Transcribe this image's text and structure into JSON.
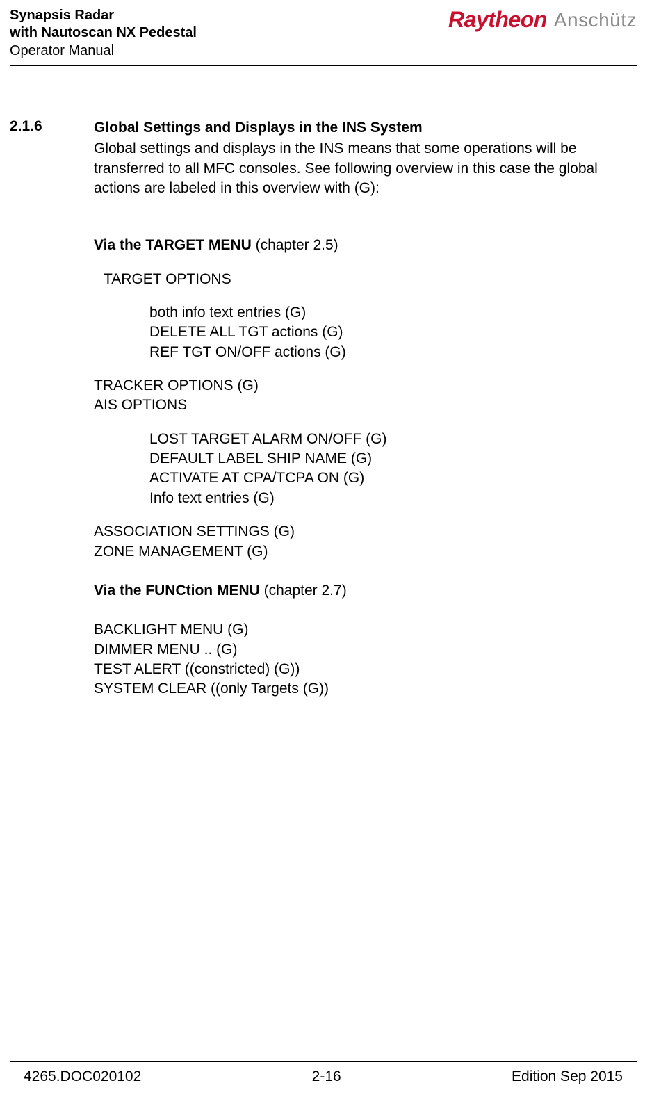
{
  "header": {
    "line1": "Synapsis Radar",
    "line2": "with Nautoscan NX Pedestal",
    "line3": "Operator Manual",
    "logo_raytheon": "Raytheon",
    "logo_anschutz": "Anschütz"
  },
  "section": {
    "num": "2.1.6",
    "title": "Global Settings and Displays in the INS System",
    "intro": "Global settings and displays in the INS means that some operations will be transferred to all MFC consoles. See following overview in this case the global actions are labeled in this overview with (G):",
    "via_target_b": "Via the TARGET MENU",
    "via_target_ch": " (chapter 2.5)",
    "target_options": "TARGET OPTIONS",
    "to_items": {
      "a": "both info text entries (G)",
      "b": "DELETE ALL TGT actions (G)",
      "c": "REF TGT ON/OFF actions (G)"
    },
    "tracker": "TRACKER OPTIONS (G)",
    "ais_options": "AIS OPTIONS",
    "ais_items": {
      "a": "LOST TARGET ALARM ON/OFF (G)",
      "b": "DEFAULT LABEL SHIP NAME (G)",
      "c": "ACTIVATE AT CPA/TCPA ON (G)",
      "d": "Info text entries (G)"
    },
    "assoc": "ASSOCIATION SETTINGS (G)",
    "zone": "ZONE MANAGEMENT (G)",
    "via_func_b": "Via the FUNCtion MENU",
    "via_func_ch": " (chapter 2.7)",
    "func_items": {
      "a": "BACKLIGHT MENU (G)",
      "b": "DIMMER MENU .. (G)",
      "c": "TEST ALERT ((constricted) (G))",
      "d": "SYSTEM CLEAR ((only Targets (G))"
    }
  },
  "footer": {
    "left": "4265.DOC020102",
    "center": "2-16",
    "right": "Edition Sep 2015"
  }
}
